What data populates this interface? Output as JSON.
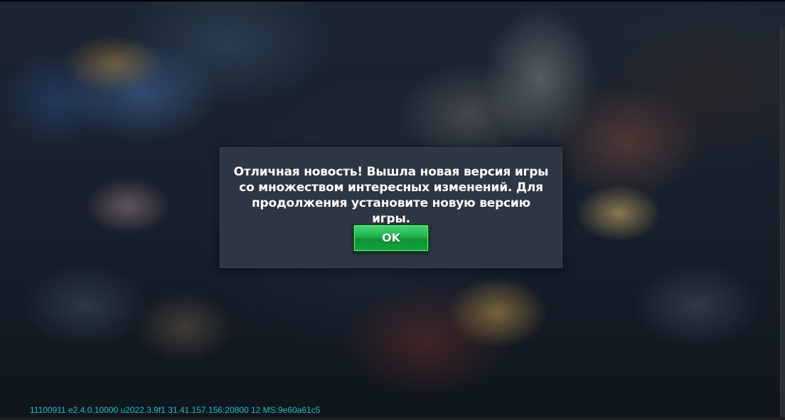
{
  "dialog": {
    "message": "Отличная новость! Вышла новая версия игры со множеством интересных изменений. Для продолжения установите новую версию игры.",
    "ok_label": "OK"
  },
  "footer": {
    "version_info": "11100911 e2.4.0.10000 u2022.3.9f1 31.41.157.156:20800 12 MS:9e60a61c5"
  },
  "colors": {
    "dialog_background": "#2c3743",
    "ok_button": "#1fb04c",
    "version_text": "#17c0c8"
  }
}
